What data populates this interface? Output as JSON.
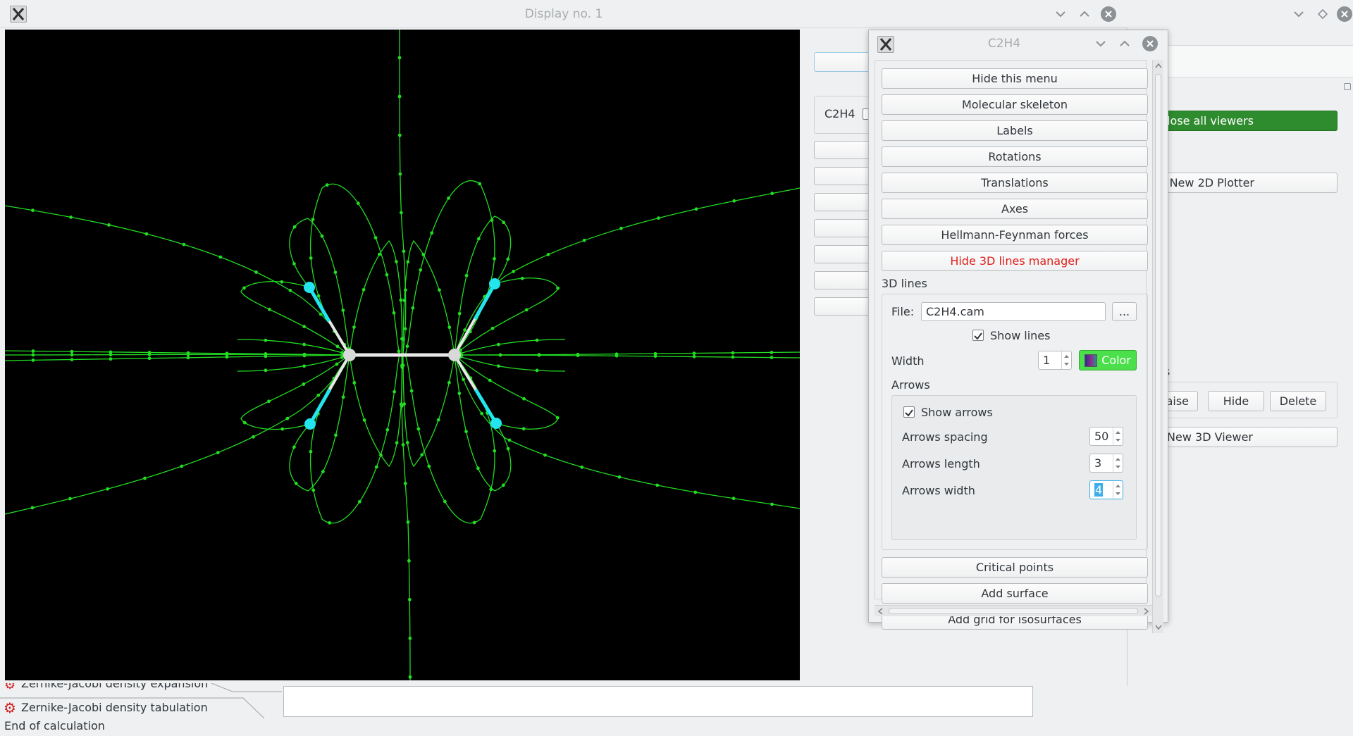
{
  "display_window": {
    "title": "Display no. 1"
  },
  "panel": {
    "molecule_name": "C2H4",
    "close_all_label": "Close all viewers",
    "new_2d_label": "New 2D Plotter",
    "section_s_label": "s",
    "raise_label": "Raise",
    "hide_label": "Hide",
    "delete_label": "Delete",
    "new_3d_label": "New 3D Viewer"
  },
  "menu": {
    "title": "C2H4",
    "buttons": {
      "hide_menu": "Hide this menu",
      "skeleton": "Molecular skeleton",
      "labels": "Labels",
      "rotations": "Rotations",
      "translations": "Translations",
      "axes": "Axes",
      "hf_forces": "Hellmann-Feynman forces",
      "hide_3d_lines": "Hide 3D lines manager",
      "critical_points": "Critical points",
      "add_surface": "Add surface",
      "add_grid": "Add grid for isosurfaces"
    },
    "lines3d": {
      "section_label": "3D lines",
      "file_label": "File:",
      "file_value": "C2H4.cam",
      "browse_label": "...",
      "show_lines_label": "Show lines",
      "show_lines_checked": true,
      "width_label": "Width",
      "width_value": "1",
      "color_label": "Color",
      "color_hex": "#4be04b",
      "arrows_label": "Arrows",
      "show_arrows_label": "Show arrows",
      "show_arrows_checked": true,
      "spacing_label": "Arrows spacing",
      "spacing_value": "50",
      "length_label": "Arrows length",
      "length_value": "3",
      "arrow_width_label": "Arrows width",
      "arrow_width_value": "4"
    }
  },
  "bottom": {
    "task_partial": "Zernike-Jacobi density expansion",
    "task_label": "Zernike-Jacobi density tabulation",
    "status": "End of calculation"
  },
  "colors": {
    "accent_green": "#2e8b2e",
    "field_lines": "#22dd22",
    "hydrogen": "#22e5ee",
    "carbon": "#d0d0d0",
    "danger_text": "#e0201c",
    "selection": "#3daee9"
  }
}
